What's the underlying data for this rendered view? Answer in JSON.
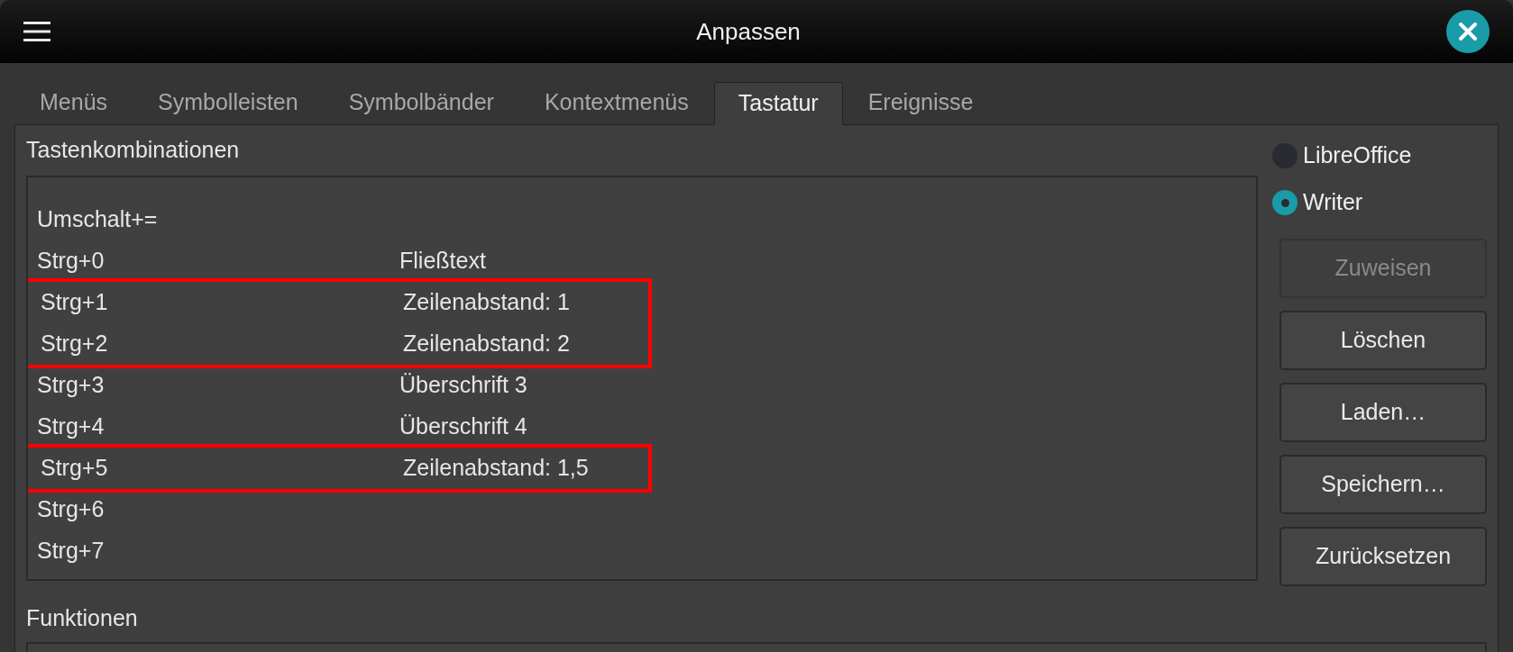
{
  "window": {
    "title": "Anpassen"
  },
  "tabs": [
    {
      "label": "Menüs",
      "selected": false
    },
    {
      "label": "Symbolleisten",
      "selected": false
    },
    {
      "label": "Symbolbänder",
      "selected": false
    },
    {
      "label": "Kontextmenüs",
      "selected": false
    },
    {
      "label": "Tastatur",
      "selected": true
    },
    {
      "label": "Ereignisse",
      "selected": false
    }
  ],
  "shortcuts": {
    "label": "Tastenkombinationen",
    "rows": [
      {
        "key": "Umschalt+=",
        "function": "",
        "highlighted": false
      },
      {
        "key": "Strg+0",
        "function": "Fließtext",
        "highlighted": false
      },
      {
        "key": "Strg+1",
        "function": "Zeilenabstand: 1",
        "highlighted": true
      },
      {
        "key": "Strg+2",
        "function": "Zeilenabstand: 2",
        "highlighted": true
      },
      {
        "key": "Strg+3",
        "function": "Überschrift 3",
        "highlighted": false
      },
      {
        "key": "Strg+4",
        "function": "Überschrift 4",
        "highlighted": false
      },
      {
        "key": "Strg+5",
        "function": "Zeilenabstand: 1,5",
        "highlighted": true
      },
      {
        "key": "Strg+6",
        "function": "",
        "highlighted": false
      },
      {
        "key": "Strg+7",
        "function": "",
        "highlighted": false
      }
    ]
  },
  "scope": [
    {
      "label": "LibreOffice",
      "selected": false
    },
    {
      "label": "Writer",
      "selected": true
    }
  ],
  "buttons": [
    {
      "label": "Zuweisen",
      "disabled": true
    },
    {
      "label": "Löschen",
      "disabled": false
    },
    {
      "label": "Laden…",
      "disabled": false
    },
    {
      "label": "Speichern…",
      "disabled": false
    },
    {
      "label": "Zurücksetzen",
      "disabled": false
    }
  ],
  "functions": {
    "label": "Funktionen"
  }
}
